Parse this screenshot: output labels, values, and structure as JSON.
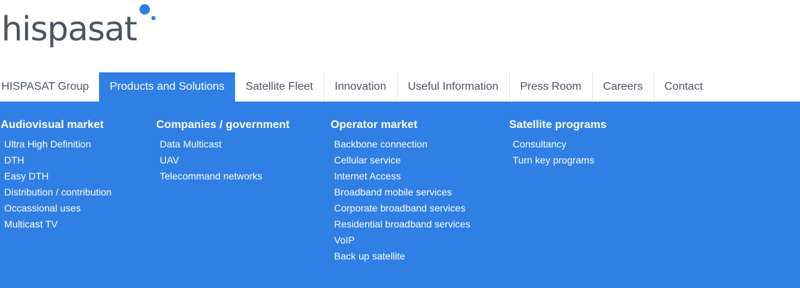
{
  "logo": {
    "text": "hispasat"
  },
  "nav": {
    "items": [
      "HISPASAT Group",
      "Products and Solutions",
      "Satellite Fleet",
      "Innovation",
      "Useful Information",
      "Press Room",
      "Careers",
      "Contact"
    ],
    "active": "Products and Solutions"
  },
  "colors": {
    "accent": "#2f7fe5",
    "text": "#4a5461",
    "panel_text": "#ffffff"
  },
  "menu": {
    "audiovisual": {
      "title": "Audiovisual market",
      "items": [
        "Ultra High Definition",
        "DTH",
        "Easy DTH",
        "Distribution / contribution",
        "Occassional uses",
        "Multicast TV"
      ]
    },
    "companies": {
      "title": "Companies / government",
      "items": [
        "Data Multicast",
        "UAV",
        "Telecommand networks"
      ]
    },
    "operator": {
      "title": "Operator market",
      "items": [
        "Backbone connection",
        "Cellular service",
        "Internet Access",
        "Broadband mobile services",
        "Corporate broadband services",
        "Residential broadband services",
        "VoIP",
        "Back up satellite"
      ]
    },
    "satellite": {
      "title": "Satellite programs",
      "items": [
        "Consultancy",
        "Turn key programs"
      ]
    }
  }
}
